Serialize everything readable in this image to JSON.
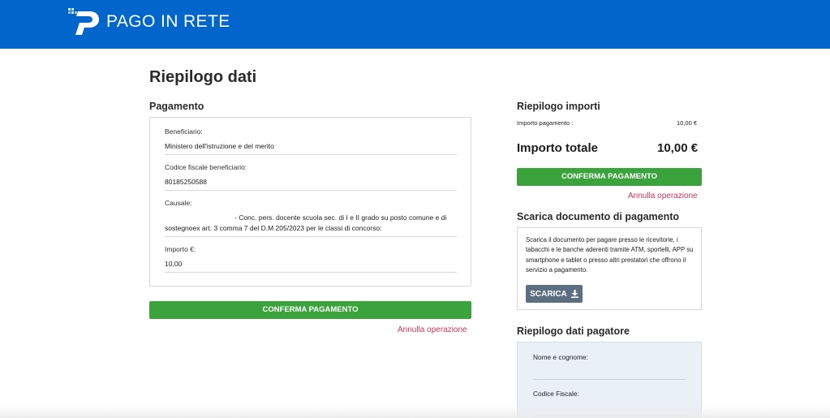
{
  "header": {
    "brand": "PAGO IN RETE",
    "logo_icon": "pago-in-rete-logo",
    "background_color": "#0066cc"
  },
  "main": {
    "page_title": "Riepilogo dati",
    "payment": {
      "section_title": "Pagamento",
      "fields": [
        {
          "label": "Beneficiario:",
          "value": "Ministero dell'istruzione e del merito"
        },
        {
          "label": "Codice fiscale beneficiario:",
          "value": "80185250588"
        },
        {
          "label": "Causale:",
          "value_line1": "- Conc. pers. docente scuola sec. di I e II grado su posto comune e di",
          "value_line2": "sostegnoex art. 3 comma 7 del D.M 205/2023 per le classi di concorso:"
        },
        {
          "label": "Importo €:",
          "value": "10,00"
        }
      ],
      "confirm_label": "CONFERMA PAGAMENTO",
      "cancel_label": "Annulla operazione"
    }
  },
  "sidebar": {
    "summary": {
      "title": "Riepilogo importi",
      "row_label": "Importo pagamento :",
      "row_value": "10,00 €",
      "total_label": "Importo totale",
      "total_value": "10,00 €",
      "confirm_label": "CONFERMA PAGAMENTO",
      "cancel_label": "Annulla operazione"
    },
    "document": {
      "title": "Scarica documento di pagamento",
      "text": "Scarica il documento per pagare presso le ricevitorie, i tabacchi e le banche aderenti tramite ATM, sportelli, APP su smartphone e tablet o presso altri prestatori che offrono il servizio a pagamento.",
      "button_label": "SCARICA",
      "button_icon": "download-icon"
    },
    "payer": {
      "title": "Riepilogo dati pagatore",
      "name_label": "Nome e cognome:",
      "cf_label": "Codice Fiscale:"
    }
  },
  "colors": {
    "accent_green": "#3ba33b",
    "link_red": "#d1345b",
    "dark_button": "#5c6f82"
  }
}
